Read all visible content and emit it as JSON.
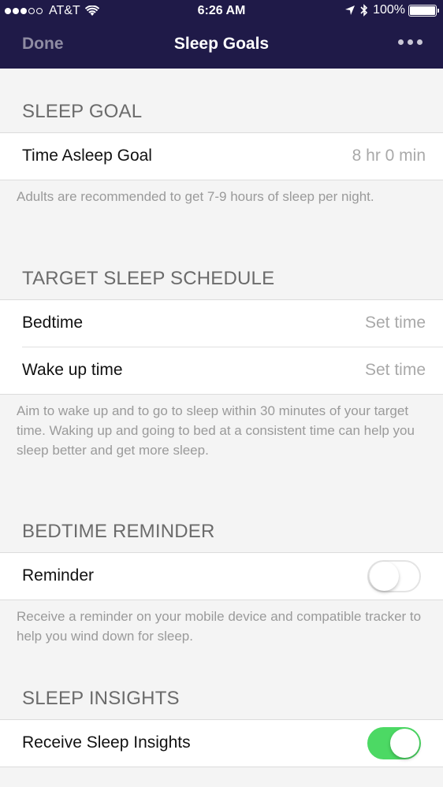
{
  "status_bar": {
    "carrier": "AT&T",
    "time": "6:26 AM",
    "battery": "100%",
    "signal_bars_filled": 3,
    "signal_bars_total": 5
  },
  "nav": {
    "done_label": "Done",
    "title": "Sleep Goals",
    "more_icon": "more-icon"
  },
  "sleep_goal": {
    "header": "SLEEP GOAL",
    "time_asleep_label": "Time Asleep Goal",
    "time_asleep_value": "8 hr 0 min",
    "note": "Adults are recommended to get 7-9 hours of sleep per night."
  },
  "schedule": {
    "header": "TARGET SLEEP SCHEDULE",
    "bedtime_label": "Bedtime",
    "bedtime_value": "Set time",
    "wake_label": "Wake up time",
    "wake_value": "Set time",
    "note": "Aim to wake up and to go to sleep within 30 minutes of your target time. Waking up and going to bed at a consistent time can help you sleep better and get more sleep."
  },
  "reminder": {
    "header": "BEDTIME REMINDER",
    "label": "Reminder",
    "enabled": false,
    "note": "Receive a reminder on your mobile device and compatible tracker to help you wind down for sleep."
  },
  "insights": {
    "header": "SLEEP INSIGHTS",
    "label": "Receive Sleep Insights",
    "enabled": true
  },
  "colors": {
    "header_bg": "#1f1a48",
    "toggle_on": "#4cd964",
    "page_bg": "#f4f4f4"
  }
}
